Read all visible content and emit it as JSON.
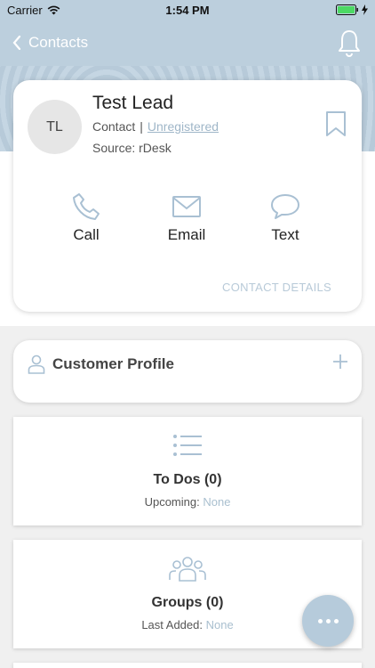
{
  "status_bar": {
    "carrier": "Carrier",
    "time": "1:54 PM"
  },
  "nav": {
    "back_label": "Contacts"
  },
  "contact": {
    "initials": "TL",
    "name": "Test Lead",
    "type": "Contact",
    "separator": "|",
    "registration": "Unregistered",
    "source": "Source: rDesk"
  },
  "actions": {
    "call": "Call",
    "email": "Email",
    "text": "Text"
  },
  "contact_details_link": "CONTACT DETAILS",
  "profile": {
    "title": "Customer Profile"
  },
  "todos": {
    "title": "To Dos (0)",
    "sub_label": "Upcoming:",
    "sub_value": "None"
  },
  "groups": {
    "title": "Groups (0)",
    "sub_label": "Last Added:",
    "sub_value": "None"
  },
  "colors": {
    "accent": "#bccfdd",
    "muted_link": "#9fb6c8",
    "icon": "#a9c0d3"
  }
}
